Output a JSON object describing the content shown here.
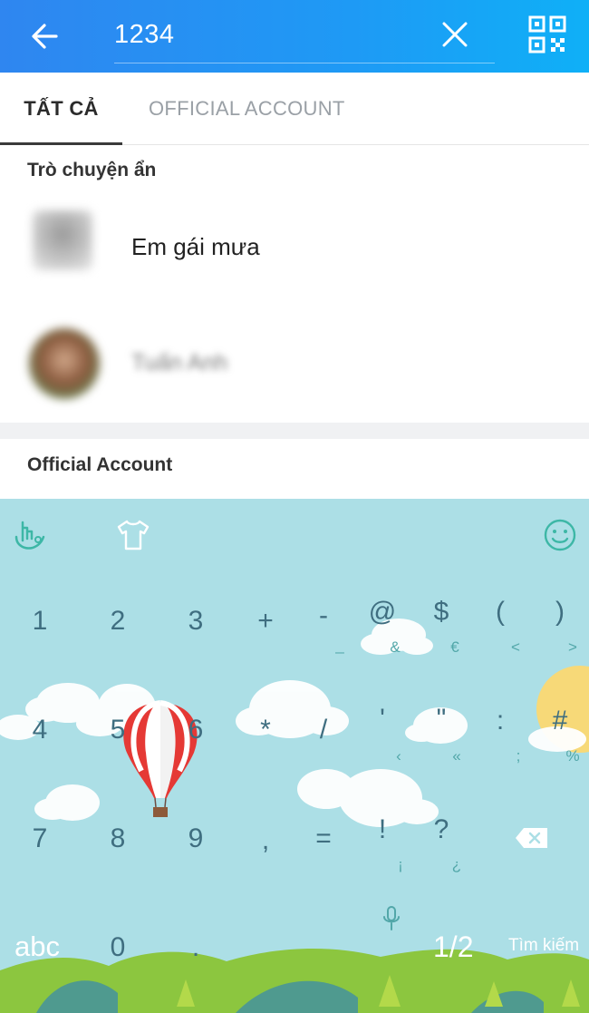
{
  "search": {
    "value": "1234"
  },
  "icons": {
    "back": "arrow-left-icon",
    "clear": "close-icon",
    "qr": "qr-code-icon",
    "keyboard_logo": "touchpal-hand-icon",
    "theme": "tshirt-icon",
    "emoji": "smiley-icon",
    "mic": "microphone-icon",
    "backspace": "backspace-icon"
  },
  "tabs": [
    {
      "label": "TẤT CẢ",
      "active": true
    },
    {
      "label": "OFFICIAL ACCOUNT",
      "active": false
    }
  ],
  "sections": {
    "hidden_chats": {
      "title": "Trò chuyện ẩn",
      "results": [
        {
          "name": "Em gái mưa",
          "blurred": false
        },
        {
          "name": "Tuấn Anh",
          "blurred": true
        }
      ]
    },
    "official": {
      "title": "Official Account"
    }
  },
  "keyboard": {
    "row1": [
      {
        "key": "1",
        "sub": ""
      },
      {
        "key": "2",
        "sub": ""
      },
      {
        "key": "3",
        "sub": ""
      },
      {
        "key": "+",
        "sub": ""
      },
      {
        "key": "-",
        "sub": "_"
      },
      {
        "key": "@",
        "sub": "&"
      },
      {
        "key": "$",
        "sub": "€"
      },
      {
        "key": "(",
        "sub": "<"
      },
      {
        "key": ")",
        "sub": ">"
      }
    ],
    "row2": [
      {
        "key": "4",
        "sub": ""
      },
      {
        "key": "5",
        "sub": ""
      },
      {
        "key": "6",
        "sub": ""
      },
      {
        "key": "*",
        "sub": ""
      },
      {
        "key": "/",
        "sub": ""
      },
      {
        "key": "'",
        "sub": "‹"
      },
      {
        "key": "\"",
        "sub": "«"
      },
      {
        "key": ":",
        "sub": ";"
      },
      {
        "key": "#",
        "sub": "%"
      }
    ],
    "row3": [
      {
        "key": "7",
        "sub": ""
      },
      {
        "key": "8",
        "sub": ""
      },
      {
        "key": "9",
        "sub": ""
      },
      {
        "key": ",",
        "sub": ""
      },
      {
        "key": "=",
        "sub": ""
      },
      {
        "key": "!",
        "sub": "¡"
      },
      {
        "key": "?",
        "sub": "¿"
      }
    ],
    "bottom": {
      "abc": "abc",
      "zero": "0",
      "dot": ".",
      "page": "1/2",
      "search": "Tìm kiếm"
    }
  }
}
